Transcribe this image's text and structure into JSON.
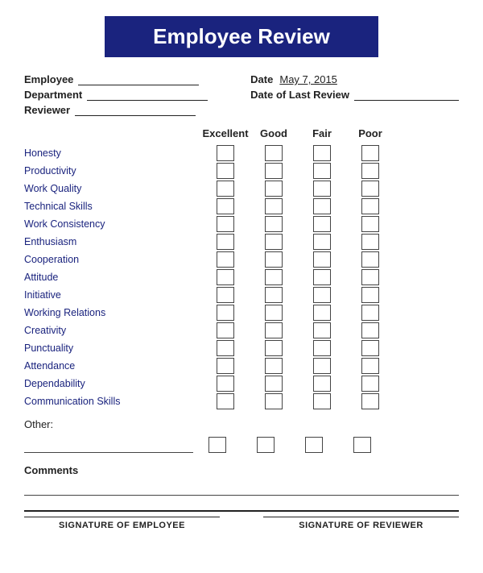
{
  "title": "Employee Review",
  "info": {
    "employee_label": "Employee",
    "department_label": "Department",
    "reviewer_label": "Reviewer",
    "date_label": "Date",
    "date_value": "May 7, 2015",
    "date_last_review_label": "Date of Last Review"
  },
  "rating_headers": [
    "Excellent",
    "Good",
    "Fair",
    "Poor"
  ],
  "criteria": [
    "Honesty",
    "Productivity",
    "Work Quality",
    "Technical Skills",
    "Work Consistency",
    "Enthusiasm",
    "Cooperation",
    "Attitude",
    "Initiative",
    "Working Relations",
    "Creativity",
    "Punctuality",
    "Attendance",
    "Dependability",
    "Communication Skills"
  ],
  "other_label": "Other:",
  "comments_label": "Comments",
  "signature_employee": "SIGNATURE OF EMPLOYEE",
  "signature_reviewer": "SIGNATURE OF REVIEWER"
}
